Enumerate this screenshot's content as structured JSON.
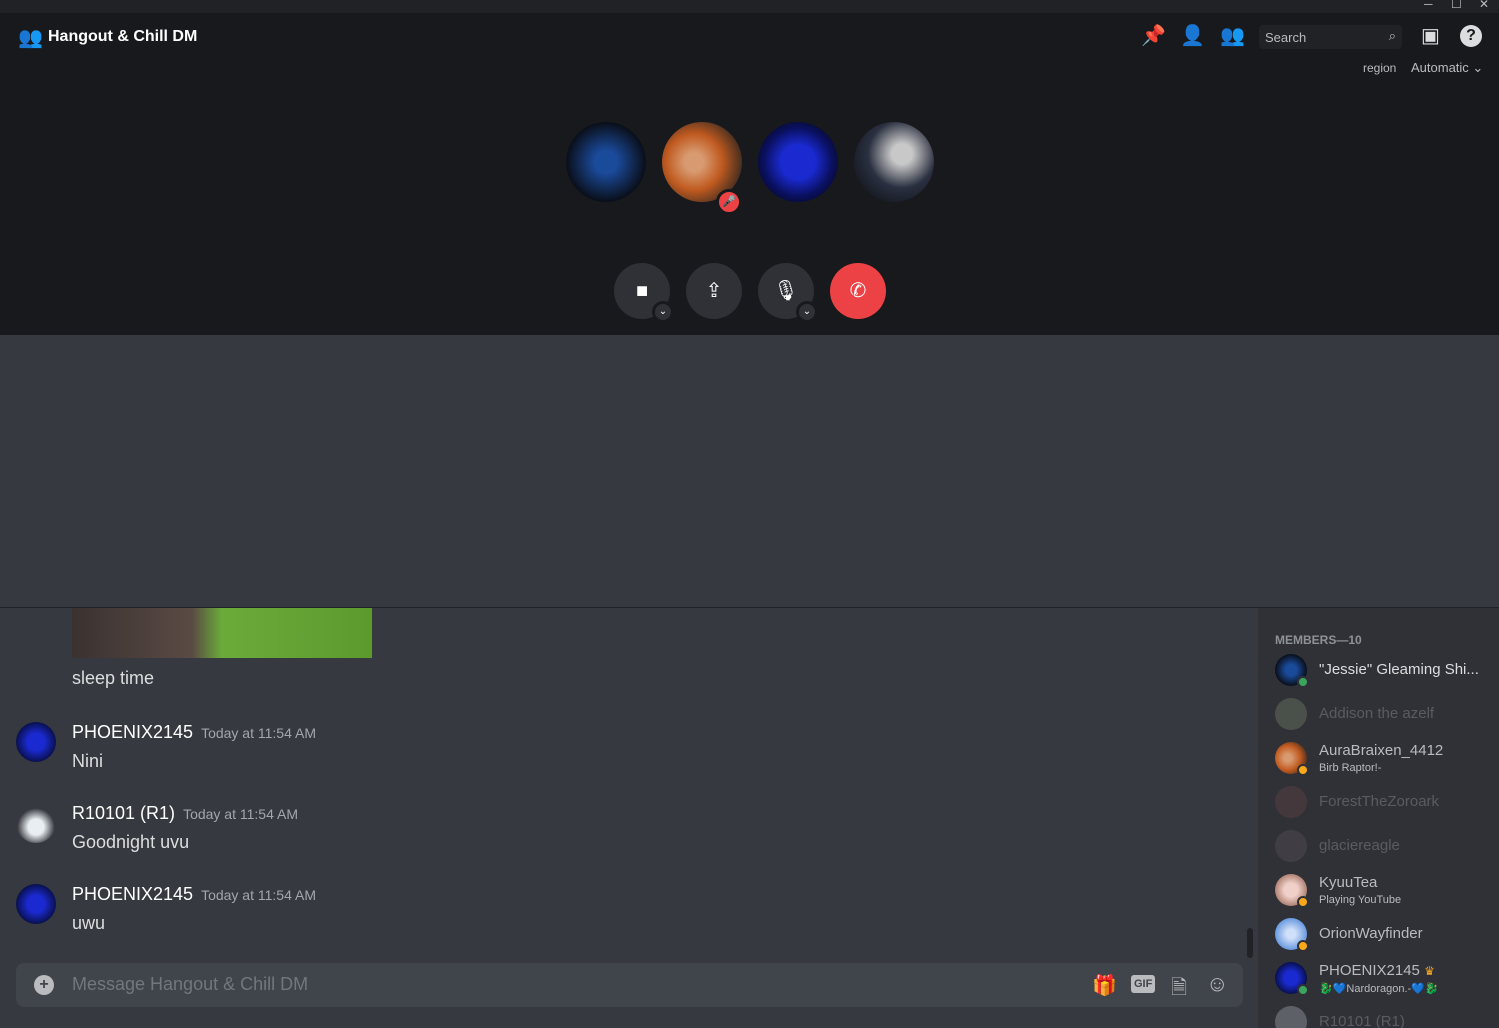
{
  "window": {
    "minimize": "─",
    "maximize": "☐",
    "close": "✕"
  },
  "header": {
    "title": "Hangout & Chill DM",
    "search_placeholder": "Search",
    "region_label": "region",
    "region_value": "Automatic"
  },
  "voice": {
    "participants": [
      "participant-1",
      "participant-2",
      "participant-3",
      "participant-4"
    ],
    "muted_index": 1
  },
  "colors": {
    "hangup": "#ed4245",
    "online": "#3ba55d",
    "idle": "#faa81a"
  },
  "messages": [
    {
      "text": "sleep time"
    },
    {
      "author": "PHOENIX2145",
      "timestamp": "Today at 11:54 AM",
      "text": "Nini"
    },
    {
      "author": "R10101 (R1)",
      "timestamp": "Today at 11:54 AM",
      "text": "Goodnight uvu"
    },
    {
      "author": "PHOENIX2145",
      "timestamp": "Today at 11:54 AM",
      "text": "uwu"
    }
  ],
  "composer": {
    "placeholder": "Message Hangout & Chill DM",
    "gif": "GIF"
  },
  "members": {
    "header": "MEMBERS—10",
    "items": [
      {
        "name": "\"Jessie\" Gleaming Shi...",
        "status": "online"
      },
      {
        "name": "Addison the azelf",
        "status": "offline"
      },
      {
        "name": "AuraBraixen_4412",
        "sub": "Birb Raptor!-",
        "status": "idle"
      },
      {
        "name": "ForestTheZoroark",
        "status": "offline"
      },
      {
        "name": "glaciereagle",
        "status": "offline"
      },
      {
        "name": "KyuuTea",
        "sub": "Playing YouTube",
        "status": "idle"
      },
      {
        "name": "OrionWayfinder",
        "status": "idle"
      },
      {
        "name": "PHOENIX2145",
        "sub": "🐉💙Nardoragon.-💙🐉",
        "status": "online",
        "owner": true
      },
      {
        "name": "R10101 (R1)",
        "status": "offline"
      }
    ]
  }
}
